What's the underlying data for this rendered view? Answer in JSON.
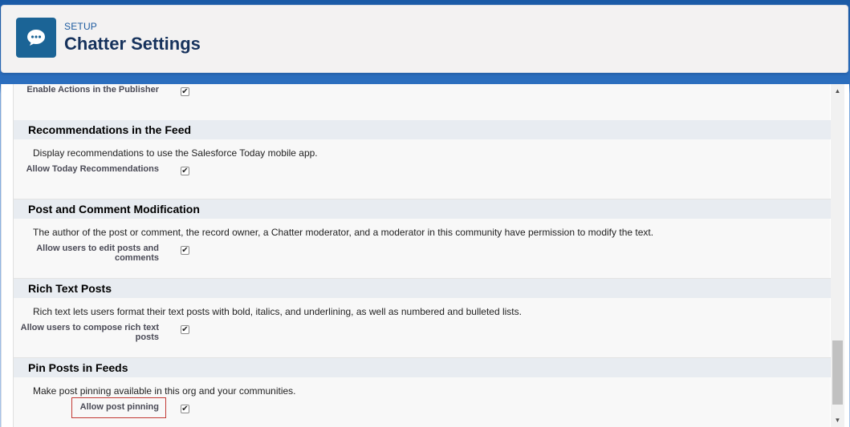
{
  "header": {
    "eyebrow": "SETUP",
    "title": "Chatter Settings",
    "icon": "chat-bubble-icon"
  },
  "top_field": {
    "label": "Enable Actions in the Publisher",
    "checked": true
  },
  "sections": [
    {
      "title": "Recommendations in the Feed",
      "description": "Display recommendations to use the Salesforce Today mobile app.",
      "field_label": "Allow Today Recommendations",
      "checked": true
    },
    {
      "title": "Post and Comment Modification",
      "description": "The author of the post or comment, the record owner, a Chatter moderator, and a moderator in this community have permission to modify the text.",
      "field_label": "Allow users to edit posts and comments",
      "checked": true
    },
    {
      "title": "Rich Text Posts",
      "description": "Rich text lets users format their text posts with bold, italics, and underlining, as well as numbered and bulleted lists.",
      "field_label": "Allow users to compose rich text posts",
      "checked": true
    },
    {
      "title": "Pin Posts in Feeds",
      "description": "Make post pinning available in this org and your communities.",
      "field_label": "Allow post pinning",
      "checked": true,
      "highlighted": true
    }
  ],
  "checkmark_glyph": "✔",
  "scrollbar": {
    "up_arrow": "▲",
    "down_arrow": "▼"
  },
  "colors": {
    "icon_bg": "#1b6496",
    "eyebrow": "#1b5a9f",
    "highlight_border": "#c23934",
    "section_header_bg": "#e8ecf1"
  }
}
